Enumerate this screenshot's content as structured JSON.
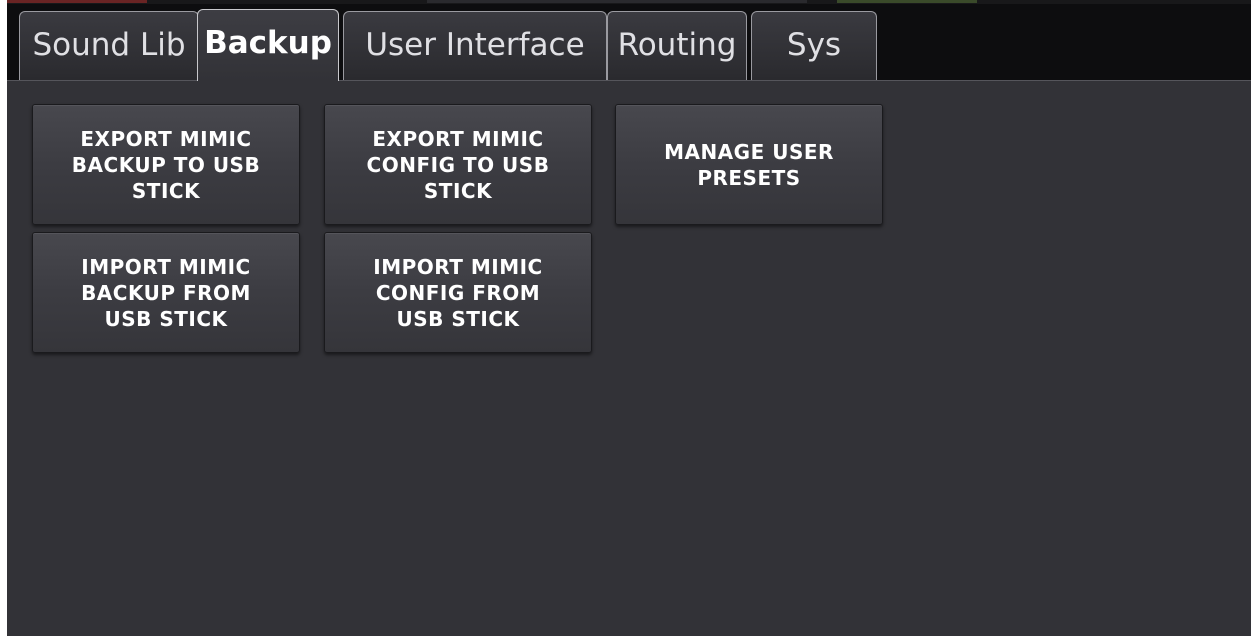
{
  "tabs": [
    {
      "label": "Sound Lib",
      "active": false
    },
    {
      "label": "Backup",
      "active": true
    },
    {
      "label": "User Interface",
      "active": false
    },
    {
      "label": "Routing",
      "active": false
    },
    {
      "label": "Sys",
      "active": false
    }
  ],
  "buttons": {
    "export_backup": "EXPORT MIMIC\nBACKUP TO USB\nSTICK",
    "export_config": "EXPORT MIMIC\nCONFIG TO USB\nSTICK",
    "manage_presets": "MANAGE USER\nPRESETS",
    "import_backup": "IMPORT MIMIC\nBACKUP FROM\nUSB STICK",
    "import_config": "IMPORT MIMIC\nCONFIG FROM\nUSB STICK"
  },
  "colors": {
    "background": "#323237",
    "tab_bar": "#0d0d0f",
    "button_face": "#3c3c42",
    "text": "#ffffff"
  }
}
